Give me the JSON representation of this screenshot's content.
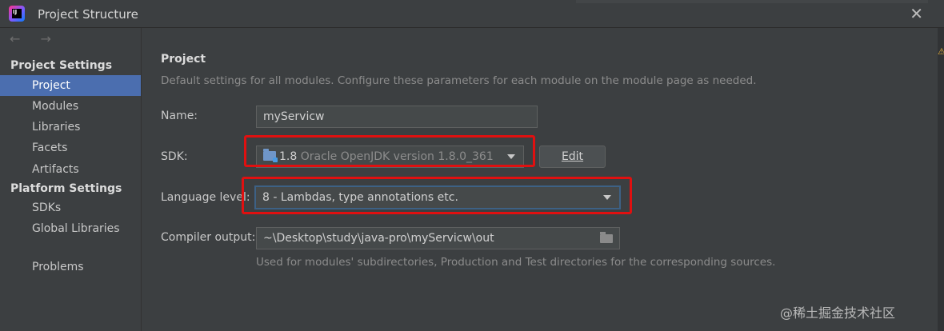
{
  "window": {
    "title": "Project Structure"
  },
  "sidebar": {
    "nav_arrows": "← →",
    "section_project_settings": "Project Settings",
    "items_project": [
      "Project",
      "Modules",
      "Libraries",
      "Facets",
      "Artifacts"
    ],
    "section_platform_settings": "Platform Settings",
    "items_platform": [
      "SDKs",
      "Global Libraries"
    ],
    "problems": "Problems",
    "active": "Project"
  },
  "main": {
    "title": "Project",
    "description": "Default settings for all modules. Configure these parameters for each module on the module page as needed.",
    "name_label": "Name:",
    "name_value": "myServicw",
    "sdk_label": "SDK:",
    "sdk_version": "1.8",
    "sdk_detail": "Oracle OpenJDK version 1.8.0_361",
    "edit_button": "Edit",
    "language_label": "Language level:",
    "language_value": "8 - Lambdas, type annotations etc.",
    "compiler_label": "Compiler output:",
    "compiler_value": "~\\Desktop\\study\\java-pro\\myServicw\\out",
    "compiler_hint": "Used for modules' subdirectories, Production and Test directories for the corresponding sources."
  },
  "watermark": "@稀土掘金技术社区",
  "colors": {
    "background": "#3c3f41",
    "selection": "#4b6eaf",
    "highlight_box": "#e01010",
    "focus_border": "#3d6185"
  }
}
